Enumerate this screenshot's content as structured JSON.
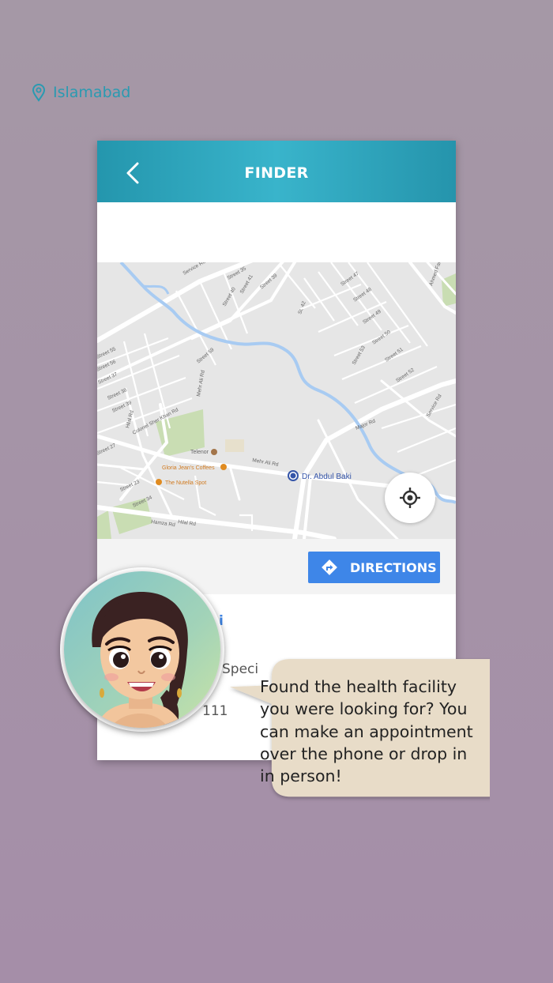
{
  "header": {
    "title": "FINDER",
    "back_icon": "chevron-left-icon"
  },
  "location": {
    "text": "Islamabad",
    "icon": "location-pin-icon"
  },
  "map": {
    "street_labels": [
      "Street 35",
      "Street 41",
      "Street 40",
      "Street 39",
      "Street 45",
      "Street 47",
      "Street 48",
      "Street 49",
      "Street 50",
      "Street 51",
      "Street 52",
      "Street 53",
      "St. 42",
      "Street 55",
      "Street 56",
      "Street 37",
      "Street 38",
      "Street 39",
      "Street 59",
      "Street 27",
      "Street 23",
      "Street 34",
      "Street 36",
      "Service Rd",
      "Service Rd E",
      "Colonel Sher Khan Rd",
      "Mehr Ali Rd",
      "Mehr Ali Rd",
      "Hamza Rd",
      "Hilal Rd",
      "Hilal Rd",
      "Major Rd",
      "Ahmed Faraz Rd",
      "Service Rd"
    ],
    "places": [
      {
        "name": "Telenor",
        "color": "#a3754a"
      },
      {
        "name": "Gloria Jean's Coffees",
        "color": "#e08b20"
      },
      {
        "name": "The Nutella Spot",
        "color": "#e08b20"
      },
      {
        "name": "Dr. Abdul Baki",
        "color": "#3454a8"
      }
    ],
    "locate_icon": "gps-crosshair-icon"
  },
  "directions": {
    "label": "DIRECTIONS",
    "icon": "turn-right-arrow-icon"
  },
  "details": {
    "partial_name": "i",
    "partial_specialty": "Speci",
    "partial_phone": "111"
  },
  "speech_bubble": {
    "lines": [
      "Found the health facility",
      "you were looking for? You",
      "can make an appointment",
      "over the phone or drop in",
      "in person!"
    ]
  },
  "colors": {
    "accent": "#2a9ab1",
    "button": "#3e86e8",
    "bubble": "#e8dcc8",
    "background": "#a594a8"
  }
}
